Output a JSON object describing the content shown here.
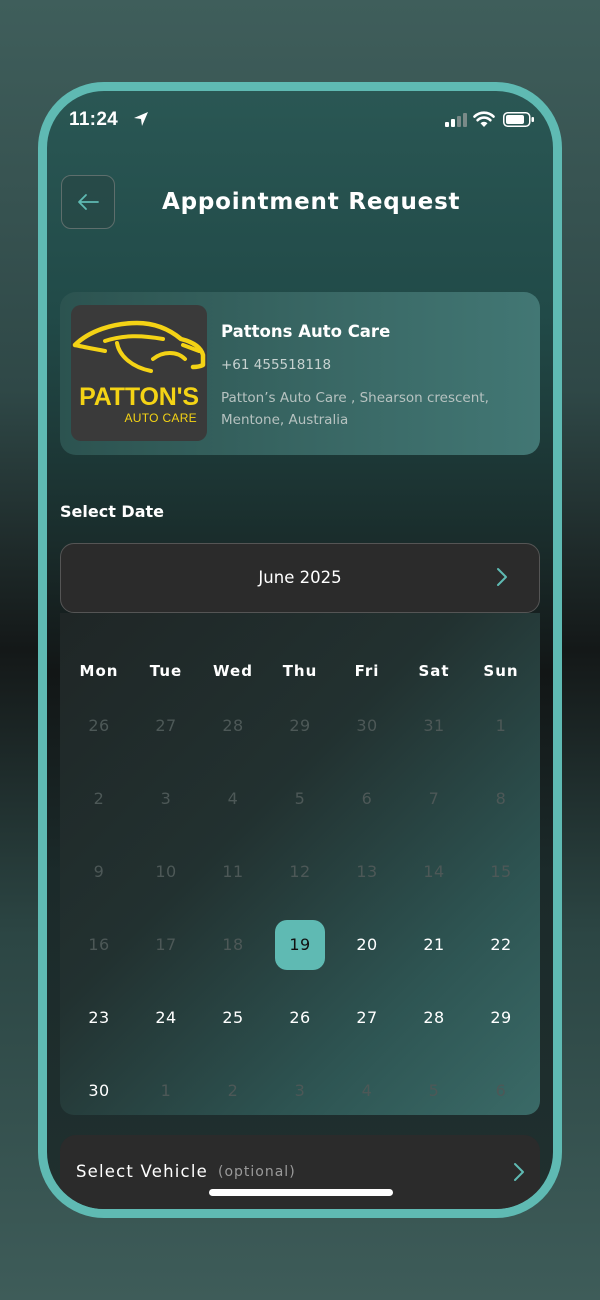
{
  "status_bar": {
    "time": "11:24"
  },
  "header": {
    "title": "Appointment Request"
  },
  "shop": {
    "logo_name": "PATTON'S",
    "logo_sub": "AUTO CARE",
    "name": "Pattons Auto Care",
    "phone": "+61 455518118",
    "address": "Patton’s Auto Care , Shearson crescent, Mentone, Australia"
  },
  "select_date_label": "Select Date",
  "calendar": {
    "month": "June 2025",
    "weekdays": [
      "Mon",
      "Tue",
      "Wed",
      "Thu",
      "Fri",
      "Sat",
      "Sun"
    ],
    "weeks": [
      [
        {
          "d": "26",
          "s": "disabled"
        },
        {
          "d": "27",
          "s": "disabled"
        },
        {
          "d": "28",
          "s": "disabled"
        },
        {
          "d": "29",
          "s": "disabled"
        },
        {
          "d": "30",
          "s": "disabled"
        },
        {
          "d": "31",
          "s": "disabled"
        },
        {
          "d": "1",
          "s": "disabled"
        }
      ],
      [
        {
          "d": "2",
          "s": "disabled"
        },
        {
          "d": "3",
          "s": "disabled"
        },
        {
          "d": "4",
          "s": "disabled"
        },
        {
          "d": "5",
          "s": "disabled"
        },
        {
          "d": "6",
          "s": "disabled"
        },
        {
          "d": "7",
          "s": "disabled"
        },
        {
          "d": "8",
          "s": "disabled"
        }
      ],
      [
        {
          "d": "9",
          "s": "disabled"
        },
        {
          "d": "10",
          "s": "disabled"
        },
        {
          "d": "11",
          "s": "disabled"
        },
        {
          "d": "12",
          "s": "disabled"
        },
        {
          "d": "13",
          "s": "disabled"
        },
        {
          "d": "14",
          "s": "disabled"
        },
        {
          "d": "15",
          "s": "disabled"
        }
      ],
      [
        {
          "d": "16",
          "s": "disabled"
        },
        {
          "d": "17",
          "s": "disabled"
        },
        {
          "d": "18",
          "s": "disabled"
        },
        {
          "d": "19",
          "s": "selected"
        },
        {
          "d": "20",
          "s": "active"
        },
        {
          "d": "21",
          "s": "active"
        },
        {
          "d": "22",
          "s": "active"
        }
      ],
      [
        {
          "d": "23",
          "s": "active"
        },
        {
          "d": "24",
          "s": "active"
        },
        {
          "d": "25",
          "s": "active"
        },
        {
          "d": "26",
          "s": "active"
        },
        {
          "d": "27",
          "s": "active"
        },
        {
          "d": "28",
          "s": "active"
        },
        {
          "d": "29",
          "s": "active"
        }
      ],
      [
        {
          "d": "30",
          "s": "active"
        },
        {
          "d": "1",
          "s": "disabled"
        },
        {
          "d": "2",
          "s": "disabled"
        },
        {
          "d": "3",
          "s": "disabled"
        },
        {
          "d": "4",
          "s": "disabled"
        },
        {
          "d": "5",
          "s": "disabled"
        },
        {
          "d": "6",
          "s": "disabled"
        }
      ]
    ]
  },
  "vehicle": {
    "label": "Select Vehicle",
    "optional": "(optional)"
  },
  "colors": {
    "accent": "#5fbab3",
    "logo_yellow": "#f4d315",
    "card_dark": "#2b2b2b"
  },
  "icons": [
    "location-arrow-icon",
    "signal-icon",
    "wifi-icon",
    "battery-icon",
    "back-arrow-icon",
    "car-silhouette-icon",
    "chevron-right-icon"
  ]
}
